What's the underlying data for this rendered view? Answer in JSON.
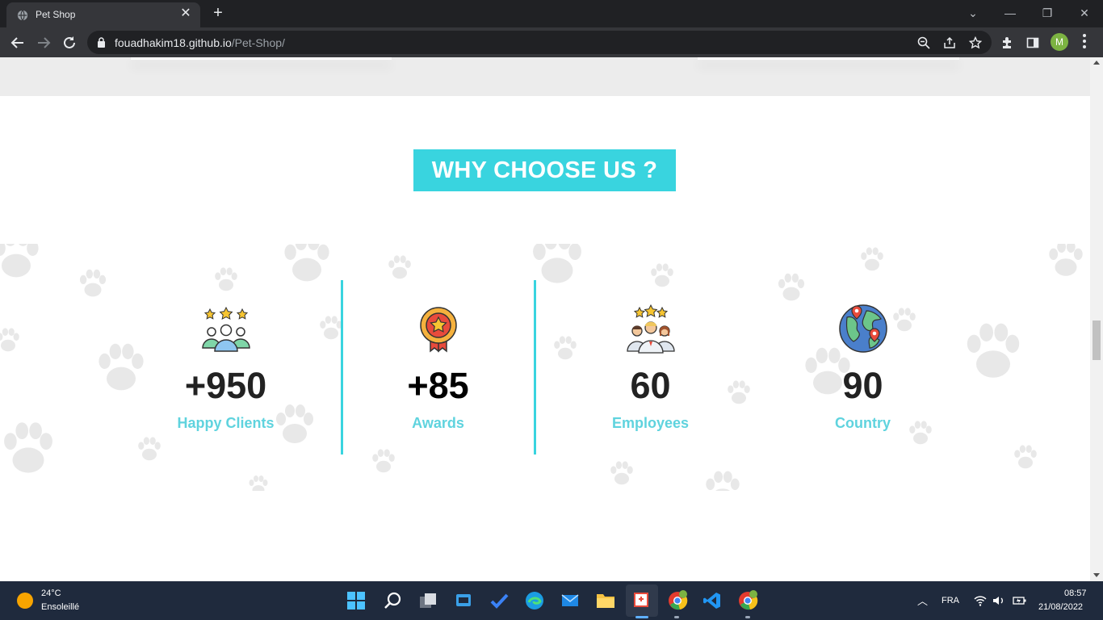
{
  "browser": {
    "tab_title": "Pet Shop",
    "url_host": "fouadhakim18.github.io",
    "url_path": "/Pet-Shop/",
    "profile_initial": "M"
  },
  "page": {
    "heading": "WHY CHOOSE US ?",
    "stats": [
      {
        "value": "+950",
        "label": "Happy Clients",
        "icon": "happy-clients-icon"
      },
      {
        "value": "+85",
        "label": "Awards",
        "icon": "award-medal-icon"
      },
      {
        "value": "60",
        "label": "Employees",
        "icon": "employees-icon"
      },
      {
        "value": "90",
        "label": "Country",
        "icon": "globe-icon"
      }
    ],
    "accent_color": "#39d4df",
    "label_color": "#5fd3de"
  },
  "taskbar": {
    "temperature": "24°C",
    "weather": "Ensoleillé",
    "language": "FRA",
    "time": "08:57",
    "date": "21/08/2022"
  }
}
